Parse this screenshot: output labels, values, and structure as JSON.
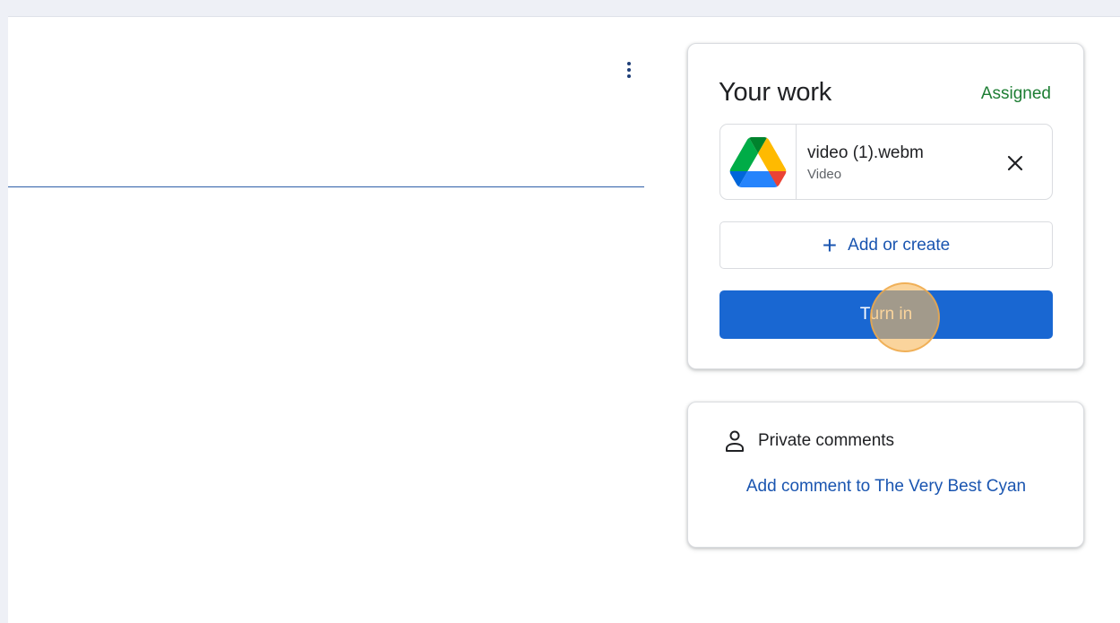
{
  "your_work": {
    "title": "Your work",
    "status": "Assigned",
    "status_color": "#1e7e34",
    "attachment": {
      "icon": "google-drive-icon",
      "name": "video (1).webm",
      "type": "Video"
    },
    "add_label": "Add or create",
    "turn_in_label": "Turn in",
    "turn_in_color": "#1967d2"
  },
  "private_comments": {
    "label": "Private comments",
    "icon": "person-icon",
    "add_comment_label": "Add comment to The Very Best Cyan"
  },
  "more_menu": {
    "icon": "more-vert-icon"
  }
}
